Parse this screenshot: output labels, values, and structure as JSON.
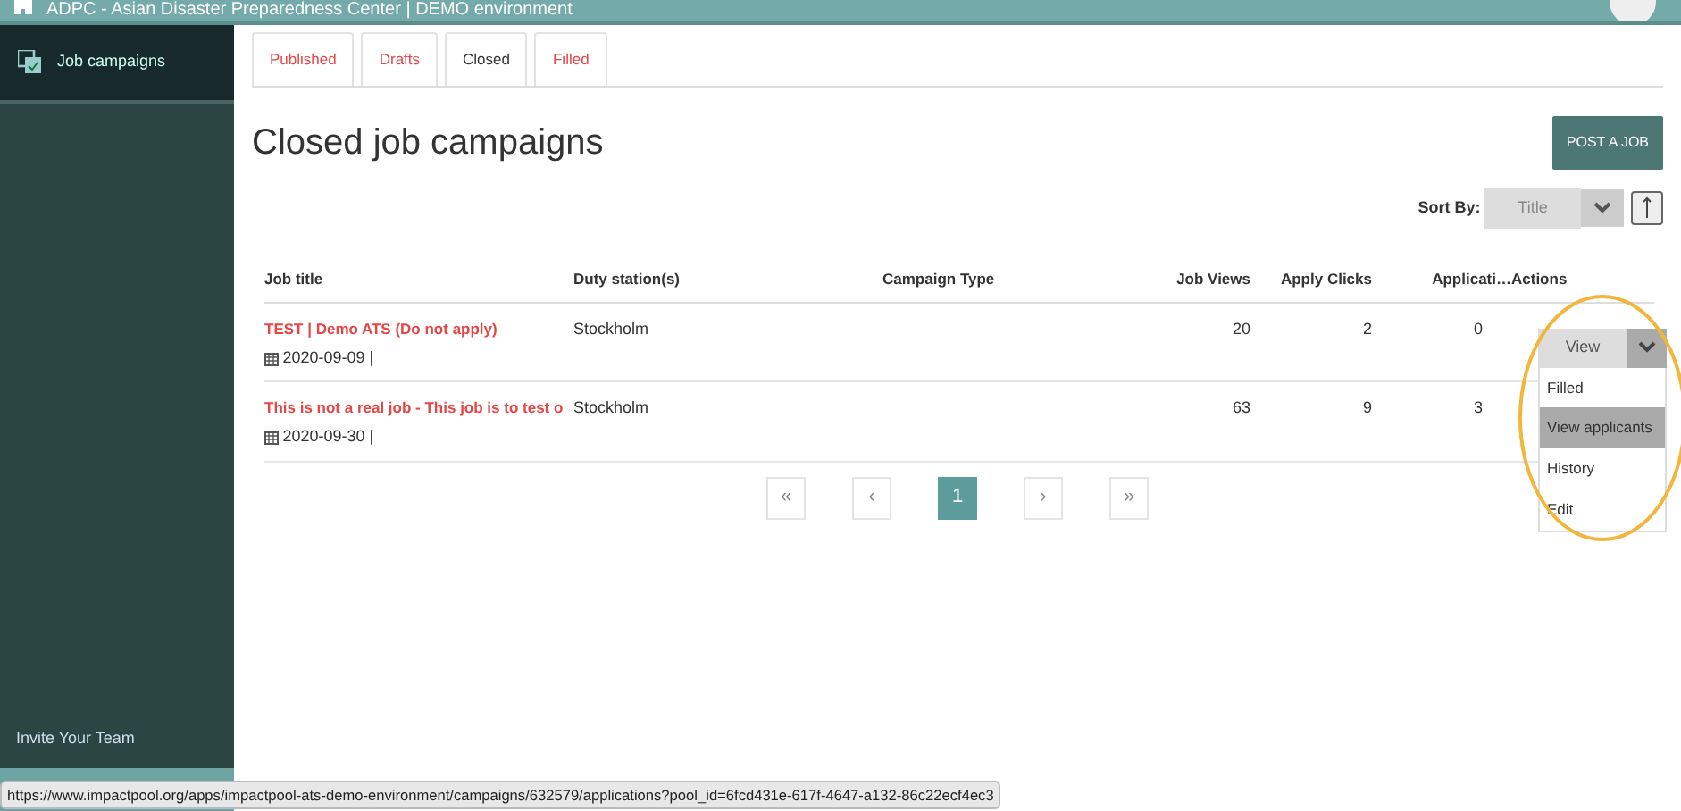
{
  "header": {
    "title": "ADPC - Asian Disaster Preparedness Center | DEMO environment"
  },
  "sidebar": {
    "items": [
      {
        "label": "Job campaigns",
        "selected": true
      }
    ],
    "footer_link": "Invite Your Team"
  },
  "tabs": [
    {
      "label": "Published",
      "selected": false
    },
    {
      "label": "Drafts",
      "selected": false
    },
    {
      "label": "Closed",
      "selected": true
    },
    {
      "label": "Filled",
      "selected": false
    }
  ],
  "page_title": "Closed job campaigns",
  "post_button": "POST A JOB",
  "sort": {
    "label": "Sort By:",
    "value": "Title"
  },
  "table": {
    "columns": [
      "Job title",
      "Duty station(s)",
      "Campaign Type",
      "Job Views",
      "Apply Clicks",
      "Applicati…",
      "Actions"
    ],
    "rows": [
      {
        "title": "TEST | Demo ATS (Do not apply)",
        "date": "2020-09-09 |",
        "station": "Stockholm",
        "views": "20",
        "clicks": "2",
        "applications": "0"
      },
      {
        "title": "This is not a real job - This job is to test o",
        "date": "2020-09-30 |",
        "station": "Stockholm",
        "views": "63",
        "clicks": "9",
        "applications": "3"
      }
    ]
  },
  "action_button": "View",
  "action_menu": [
    {
      "label": "Filled",
      "selected": false
    },
    {
      "label": "View applicants",
      "selected": true
    },
    {
      "label": "History",
      "selected": false
    },
    {
      "label": "Edit",
      "selected": false
    }
  ],
  "pagination": [
    {
      "label": "«",
      "selected": false
    },
    {
      "label": "‹",
      "selected": false
    },
    {
      "label": "1",
      "selected": true
    },
    {
      "label": "›",
      "selected": false
    },
    {
      "label": "»",
      "selected": false
    }
  ],
  "status_bar": "https://www.impactpool.org/apps/impactpool-ats-demo-environment/campaigns/632579/applications?pool_id=6fcd431e-617f-4647-a132-86c22ecf4ec3"
}
